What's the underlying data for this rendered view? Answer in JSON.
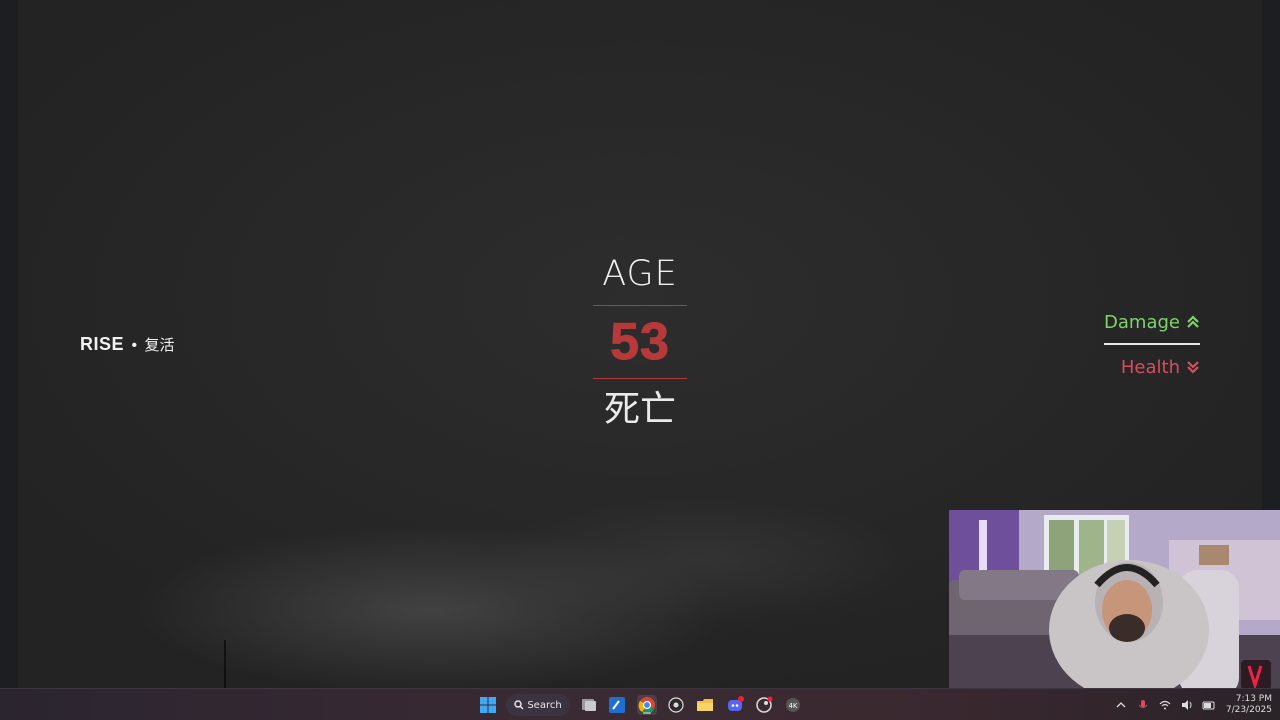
{
  "hud": {
    "age_label": "AGE",
    "age_value": "53",
    "age_status": "死亡",
    "rise_title": "RISE",
    "rise_separator": "•",
    "rise_chinese": "复活"
  },
  "stats": [
    {
      "label": "Damage",
      "direction": "up",
      "color": "#7fd36b",
      "icon": "chevron-double-up-icon"
    },
    {
      "label": "Health",
      "direction": "down",
      "color": "#d64e5e",
      "icon": "chevron-double-down-icon"
    }
  ],
  "taskbar": {
    "search_label": "Search",
    "apps": [
      "windows-start-icon",
      "search",
      "task-view-icon",
      "editor-app-icon",
      "chrome-icon",
      "obs-icon",
      "file-explorer-icon",
      "discord-icon",
      "steam-icon",
      "4k-app-icon"
    ],
    "clock_time": "7:13 PM",
    "clock_date": "7/23/2025"
  },
  "colors": {
    "accent_red": "#b83939",
    "damage_green": "#7fd36b",
    "health_red": "#d64e5e"
  }
}
